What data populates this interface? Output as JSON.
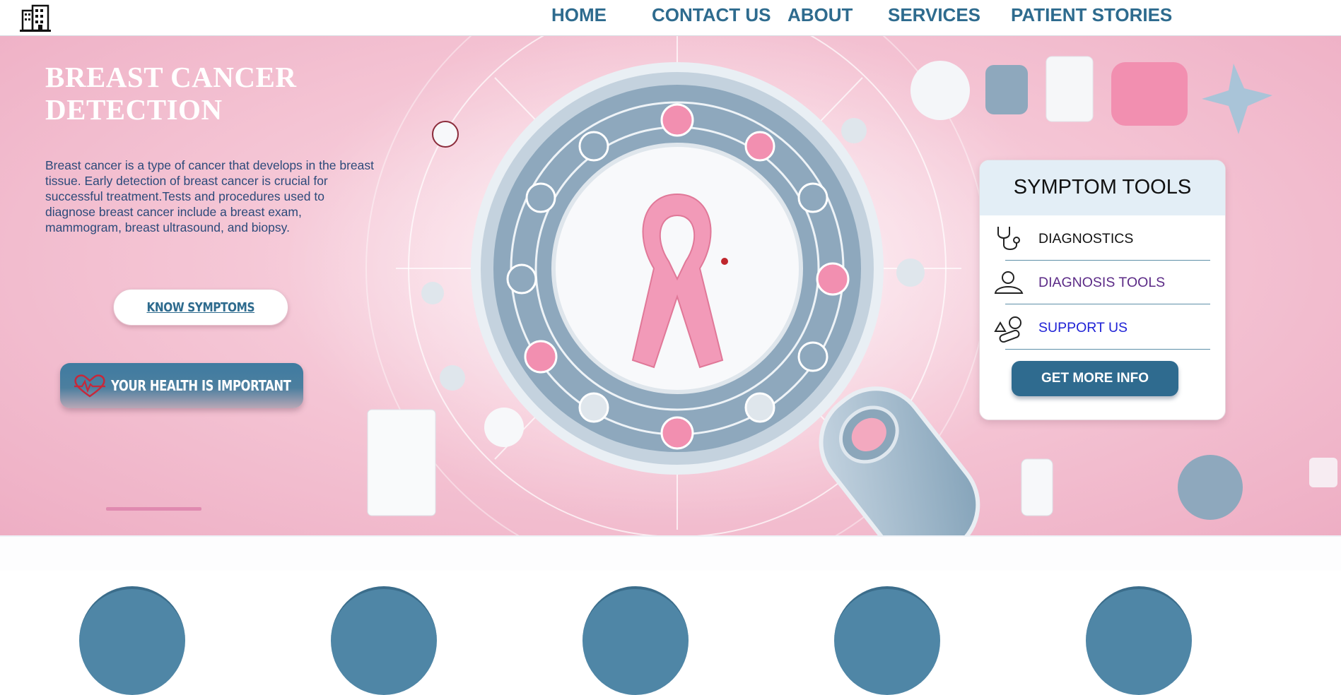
{
  "nav": {
    "logo_icon": "hospital-building-icon",
    "links": [
      "HOME",
      "CONTACT US",
      "ABOUT",
      "SERVICES",
      "PATIENT STORIES"
    ]
  },
  "hero": {
    "title": "BREAST CANCER DETECTION",
    "description": "Breast cancer is a type of cancer that develops in the breast tissue. Early detection of breast cancer is crucial for successful treatment.Tests and procedures used to diagnose breast cancer include a breast exam, mammogram, breast ultrasound, and biopsy.",
    "know_symptoms_label": "KNOW SYMPTOMS",
    "health_label": "YOUR HEALTH IS IMPORTANT",
    "health_icon": "heartbeat-icon"
  },
  "symptom_tools": {
    "title": "SYMPTOM TOOLS",
    "items": [
      {
        "label": "DIAGNOSTICS",
        "icon": "stethoscope-icon",
        "color": "#111111"
      },
      {
        "label": "DIAGNOSIS TOOLS",
        "icon": "person-icon",
        "color": "#5b2a86"
      },
      {
        "label": "SUPPORT US",
        "icon": "pills-icon",
        "color": "#1f22d6"
      }
    ],
    "cta_label": "GET MORE INFO"
  },
  "colors": {
    "brand": "#2e6b8e",
    "hero_pink": "#f5c7d6",
    "card_header": "#e3eef6"
  }
}
